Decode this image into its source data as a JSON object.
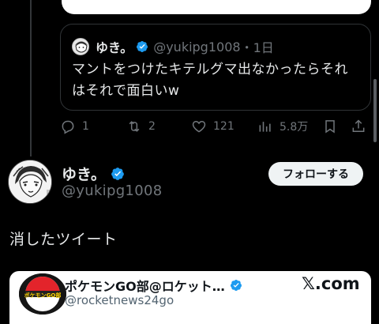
{
  "colors": {
    "background": "#000000",
    "text_primary": "#e7e9ea",
    "text_secondary": "#71767b",
    "verified_blue": "#1d9bf0",
    "border": "#2f3336"
  },
  "quote_tweet": {
    "author_name": "ゆき。",
    "verified_icon": "verified-badge-icon",
    "handle": "@yukipg1008",
    "time": "・1日",
    "text_line1": "マントをつけたキテルグマ出なかったらそれ",
    "text_line2": "はそれで面白いw"
  },
  "actions": {
    "reply": {
      "icon": "reply-icon",
      "count": "1"
    },
    "retweet": {
      "icon": "retweet-icon",
      "count": "2"
    },
    "like": {
      "icon": "heart-icon",
      "count": "121"
    },
    "views": {
      "icon": "views-icon",
      "count": "5.8万"
    },
    "bookmark": {
      "icon": "bookmark-icon"
    },
    "share": {
      "icon": "share-icon"
    }
  },
  "tweet": {
    "author_name": "ゆき。",
    "handle": "@yukipg1008",
    "follow_label": "フォローする",
    "text": "消したツイート"
  },
  "embed": {
    "account_name": "ポケモンGO部@ロケット…",
    "handle": "@rocketnews24go",
    "brand": "𝕏.com",
    "logo_text": "ポケモンGO部"
  }
}
